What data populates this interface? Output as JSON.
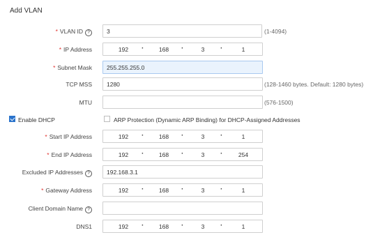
{
  "title": "Add VLAN",
  "vlan_id": {
    "label": "VLAN ID",
    "value": "3",
    "hint": "(1-4094)"
  },
  "ip_address": {
    "label": "IP Address",
    "octets": [
      "192",
      "168",
      "3",
      "1"
    ]
  },
  "subnet_mask": {
    "label": "Subnet Mask",
    "value": "255.255.255.0"
  },
  "tcp_mss": {
    "label": "TCP MSS",
    "value": "1280",
    "hint": "(128-1460 bytes. Default: 1280 bytes)"
  },
  "mtu": {
    "label": "MTU",
    "value": "",
    "hint": "(576-1500)"
  },
  "enable_dhcp": {
    "label": "Enable DHCP",
    "checked": true
  },
  "arp_protection": {
    "label": "ARP Protection (Dynamic ARP Binding) for DHCP-Assigned Addresses",
    "checked": false
  },
  "start_ip": {
    "label": "Start IP Address",
    "octets": [
      "192",
      "168",
      "3",
      "1"
    ]
  },
  "end_ip": {
    "label": "End IP Address",
    "octets": [
      "192",
      "168",
      "3",
      "254"
    ]
  },
  "excluded_ip": {
    "label": "Excluded IP Addresses",
    "value": "192.168.3.1"
  },
  "gateway": {
    "label": "Gateway Address",
    "octets": [
      "192",
      "168",
      "3",
      "1"
    ]
  },
  "client_domain": {
    "label": "Client Domain Name",
    "value": ""
  },
  "dns1": {
    "label": "DNS1",
    "octets": [
      "192",
      "168",
      "3",
      "1"
    ]
  },
  "colors": {
    "required": "#e0322e",
    "checkbox": "#2a73cc",
    "focus_bg": "#eaf3fd"
  },
  "icons": {
    "help": "help-circle-icon",
    "check": "check-icon"
  }
}
